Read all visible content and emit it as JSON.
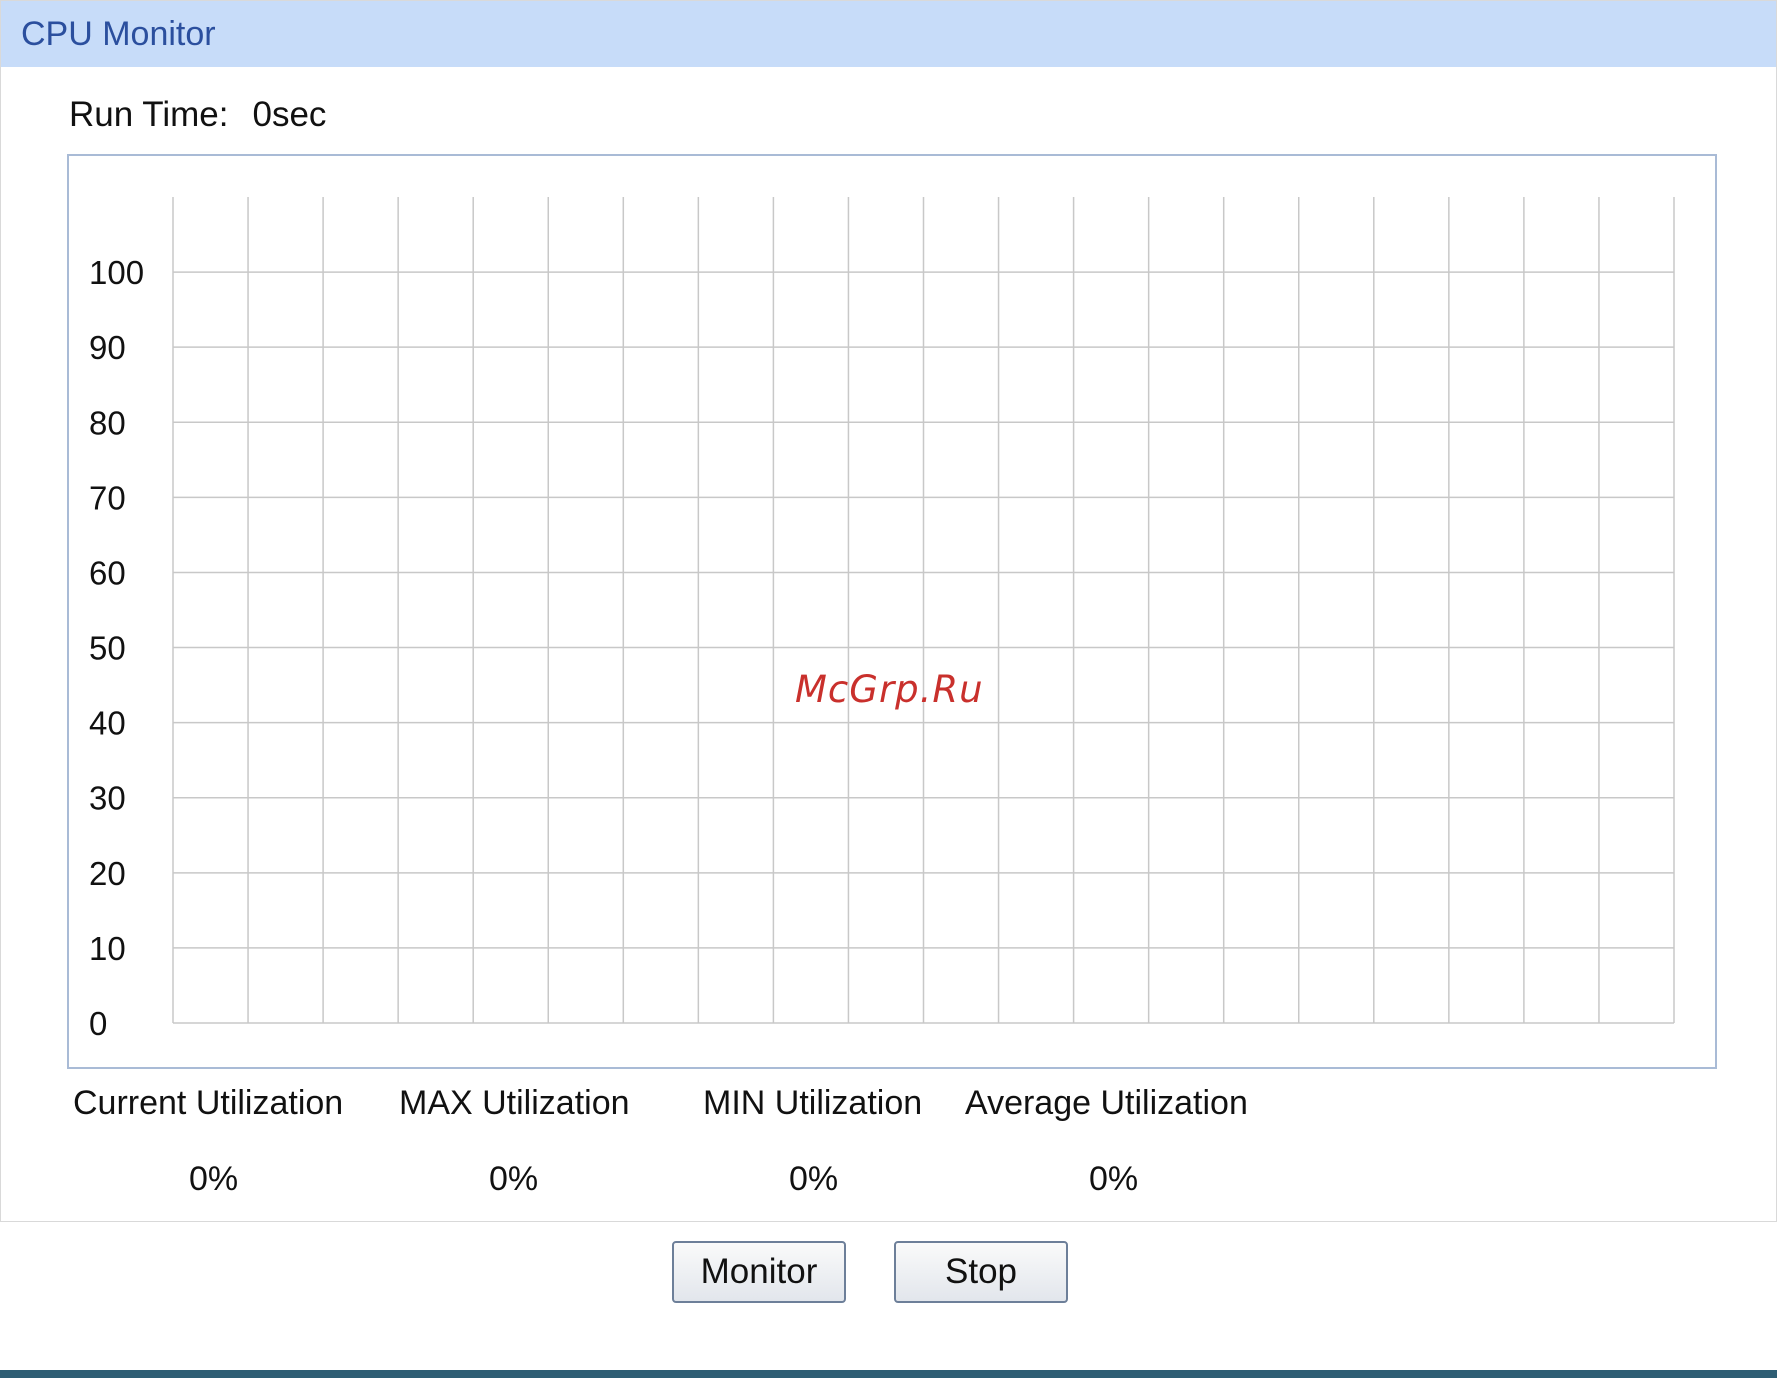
{
  "header": {
    "title": "CPU Monitor"
  },
  "runtime": {
    "label": "Run Time:",
    "value": "0sec"
  },
  "chart_data": {
    "type": "line",
    "title": "",
    "xlabel": "",
    "ylabel": "",
    "yticks": [
      "100",
      "90",
      "80",
      "70",
      "60",
      "50",
      "40",
      "30",
      "20",
      "10",
      "0"
    ],
    "ylim": [
      0,
      110
    ],
    "x_divisions": 20,
    "grid": true,
    "series": []
  },
  "stats": {
    "current_label": "Current Utilization",
    "current_value": "0%",
    "max_label": "MAX Utilization",
    "max_value": "0%",
    "min_label": "MIN Utilization",
    "min_value": "0%",
    "avg_label": "Average Utilization",
    "avg_value": "0%"
  },
  "buttons": {
    "monitor": "Monitor",
    "stop": "Stop"
  },
  "watermark": "McGrp.Ru",
  "colors": {
    "header_bg": "#c7dcf9",
    "title": "#2b4f9e",
    "grid": "#c8c8c8",
    "footer": "#2e5e74"
  }
}
